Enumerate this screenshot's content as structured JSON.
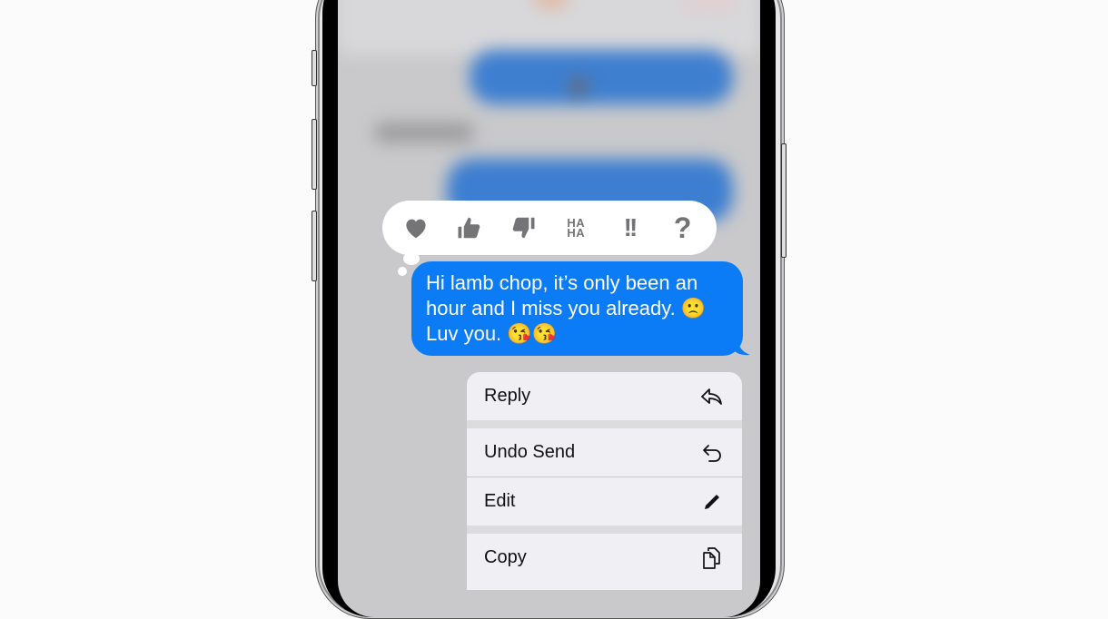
{
  "tapbacks": [
    {
      "name": "heart",
      "label": ""
    },
    {
      "name": "thumbs-up",
      "label": ""
    },
    {
      "name": "thumbs-down",
      "label": ""
    },
    {
      "name": "haha",
      "label_line1": "HA",
      "label_line2": "HA"
    },
    {
      "name": "emphasize",
      "label": "!!"
    },
    {
      "name": "question",
      "label": "?"
    }
  ],
  "message": {
    "text": "Hi lamb chop, it’s only been an hour and I miss you already. 🙁 Luv you. 😘😘",
    "bubble_color": "#0b7cf5"
  },
  "menu": {
    "items": [
      {
        "label": "Reply",
        "icon": "reply-icon"
      },
      {
        "label": "Undo Send",
        "icon": "undo-icon"
      },
      {
        "label": "Edit",
        "icon": "pencil-icon"
      },
      {
        "label": "Copy",
        "icon": "copy-icon"
      }
    ]
  }
}
